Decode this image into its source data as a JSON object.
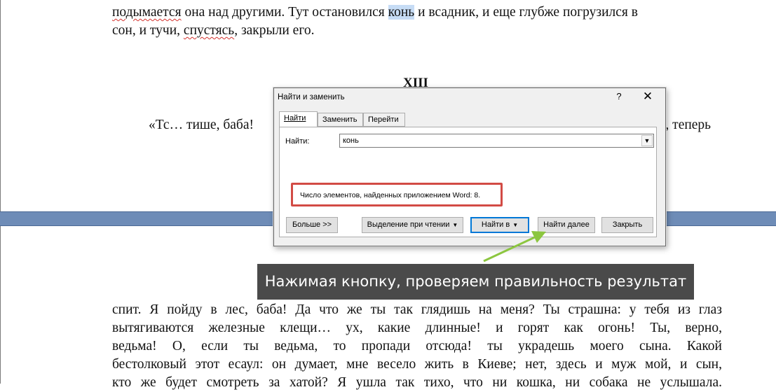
{
  "document": {
    "top_lines": [
      {
        "parts": [
          {
            "text": "подымается",
            "spell": true
          },
          {
            "text": " она над другими. Тут остановился "
          },
          {
            "text": "конь",
            "highlight": true
          },
          {
            "text": " и всадник, и еще глубже погрузился в"
          }
        ]
      },
      {
        "parts": [
          {
            "text": "сон, и тучи, "
          },
          {
            "text": "спустясь",
            "spell": true
          },
          {
            "text": ", закрыли его."
          }
        ]
      }
    ],
    "chapter_heading": "XIII",
    "quote_start_left": "«Тс… тише, баба!",
    "quote_start_right": "і, теперь",
    "bottom_lines": [
      "спит. Я пойду в лес, баба! Да что же ты так глядишь на меня? Ты страшна: у тебя из глаз",
      "вытягиваются железные клещи… ух, какие длинные! и горят как огонь! Ты, верно,",
      "ведьма! О, если ты ведьма, то пропади отсюда! ты украдешь моего сына. Какой",
      "бестолковый этот есаул: он думает, мне весело жить в Киеве; нет, здесь и муж мой, и сын,",
      "кто же будет смотреть за хатой? Я ушла так тихо, что ни кошка, ни собака не услышала."
    ]
  },
  "dialog": {
    "title": "Найти и заменить",
    "help_label": "?",
    "close_label": "✕",
    "tabs": [
      {
        "label": "Найти",
        "active": true
      },
      {
        "label": "Заменить",
        "active": false
      },
      {
        "label": "Перейти",
        "active": false
      }
    ],
    "find_label": "Найти:",
    "find_value": "конь",
    "status_message": "Число элементов, найденных приложением Word: 8.",
    "buttons": {
      "more": "Больше >>",
      "reading_highlight": "Выделение при чтении",
      "find_in": "Найти в",
      "find_next": "Найти далее",
      "close": "Закрыть"
    }
  },
  "callout": {
    "text": "Нажимая кнопку, проверяем правильность результат"
  },
  "colors": {
    "callout_bg": "#4a4a4a",
    "status_border": "#d24b45",
    "arrow": "#8cc63f",
    "highlight": "#c6dcf5",
    "page_gap": "#6e8cb7"
  }
}
